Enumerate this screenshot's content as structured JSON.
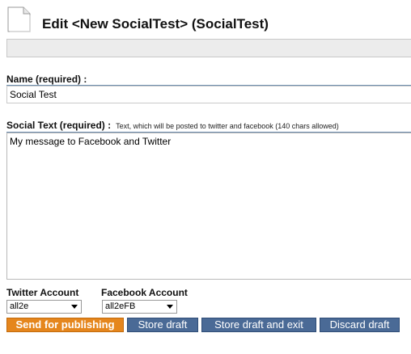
{
  "header": {
    "title": "Edit <New SocialTest> (SocialTest)",
    "icon": "document-icon"
  },
  "form": {
    "name": {
      "label": "Name (required) :",
      "value": "Social Test"
    },
    "social_text": {
      "label": "Social Text (required) :",
      "hint": "Text, which will be posted to twitter and facebook (140 chars allowed)",
      "value": "My message to Facebook and Twitter"
    },
    "twitter_account": {
      "label": "Twitter Account",
      "selected": "all2e"
    },
    "facebook_account": {
      "label": "Facebook Account",
      "selected": "all2eFB"
    }
  },
  "actions": {
    "send": "Send for publishing",
    "store_draft": "Store draft",
    "store_draft_exit": "Store draft and exit",
    "discard_draft": "Discard draft"
  },
  "colors": {
    "primary_button": "#e5861d",
    "secondary_button": "#4a6a96",
    "field_rule": "#6f8fb0"
  }
}
